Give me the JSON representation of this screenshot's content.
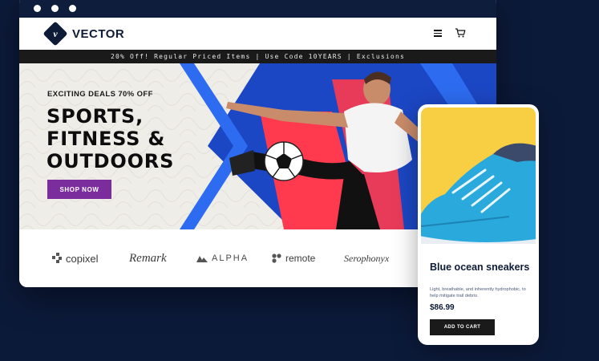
{
  "site": {
    "logo_text": "VECTOR",
    "logo_letter": "v",
    "promo": "20% Off! Regular Priced Items | Use Code 10YEARS | Exclusions"
  },
  "hero": {
    "eyebrow": "EXCITING DEALS 70% OFF",
    "title_lines": [
      "SPORTS,",
      "FITNESS &",
      "OUTDOORS"
    ],
    "cta": "SHOP NOW"
  },
  "brands": [
    "copixel",
    "Remark",
    "ALPHA",
    "remote",
    "Serophonyx"
  ],
  "product": {
    "name": "Blue ocean sneakers",
    "description": "Light, breathable, and inherently hydrophobic, to help mitigate trail debris.",
    "price": "$86.99",
    "cta": "ADD TO CART"
  },
  "icons": {
    "menu": "menu-icon",
    "cart": "cart-icon"
  },
  "colors": {
    "page_bg": "#0c1a3a",
    "accent_purple": "#7b2d9e",
    "hero_blue": "#1c47c4",
    "hero_red": "#ff3a4e",
    "product_bg": "#f8cf43",
    "shoe_blue": "#29a9dc"
  }
}
